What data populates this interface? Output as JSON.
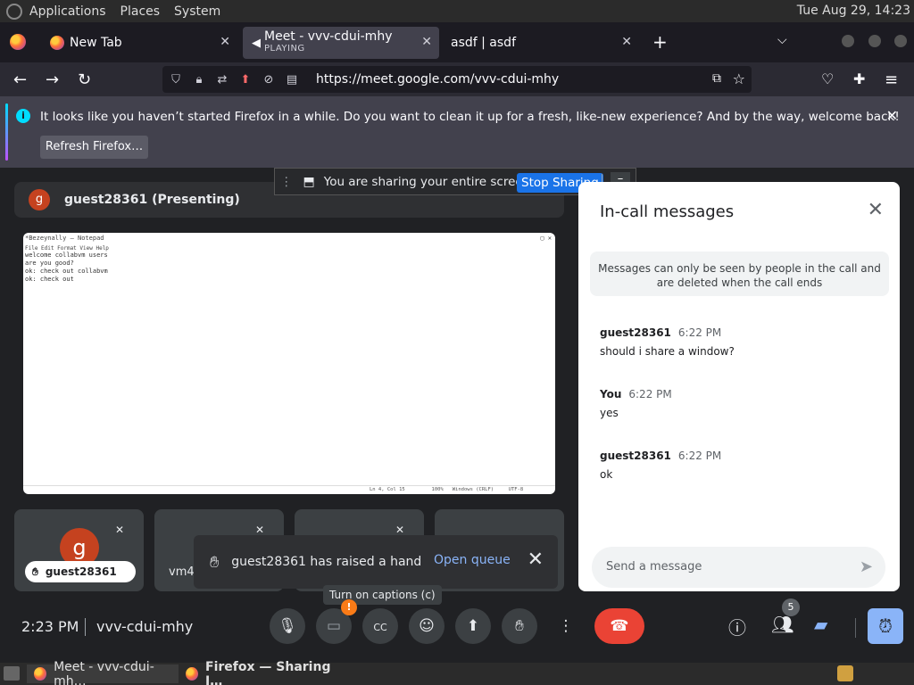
{
  "system": {
    "menus": [
      "Applications",
      "Places",
      "System"
    ],
    "clock": "Tue Aug 29, 14:23"
  },
  "tabs": [
    {
      "label": "New Tab"
    },
    {
      "label": "Meet - vvv-cdui-mhy",
      "sub": "PLAYING"
    },
    {
      "label": "asdf | asdf"
    }
  ],
  "url": "https://meet.google.com/vvv-cdui-mhy",
  "notification": {
    "message": "It looks like you haven’t started Firefox in a while. Do you want to clean it up for a fresh, like-new experience? And by the way, welcome back!",
    "button": "Refresh Firefox…"
  },
  "sharing": {
    "message": "You are sharing your entire screen.",
    "stop": "Stop Sharing",
    "minimize": "–"
  },
  "presenter": {
    "initial": "g",
    "label": "guest28361 (Presenting)"
  },
  "shared_screen": {
    "title": "*Bezeynally — Notepad",
    "menu": "File  Edit  Format  View  Help",
    "lines": [
      "welcome collabvm users",
      "are you good?",
      "ok: check out collabvm",
      "ok: check out"
    ],
    "status": "Ln 4, Col 15         100%   Windows (CRLF)     UTF-8"
  },
  "tiles": [
    {
      "initial": "g",
      "name": "guest28361"
    },
    {
      "name": "vm4"
    }
  ],
  "toast": {
    "message": "guest28361 has raised a hand",
    "action": "Open queue"
  },
  "tooltip": "Turn on captions (c)",
  "chat": {
    "title": "In-call messages",
    "notice": "Messages can only be seen by people in the call and are deleted when the call ends",
    "messages": [
      {
        "sender": "guest28361",
        "time": "6:22 PM",
        "text": "should i share a window?"
      },
      {
        "sender": "You",
        "time": "6:22 PM",
        "text": "yes"
      },
      {
        "sender": "guest28361",
        "time": "6:22 PM",
        "text": "ok"
      }
    ],
    "placeholder": "Send a message"
  },
  "controls": {
    "time": "2:23 PM",
    "meeting_code": "vvv-cdui-mhy",
    "camera_badge": "!",
    "people_count": "5"
  },
  "taskbar": [
    {
      "label": "Meet - vvv-cdui-mh…"
    },
    {
      "label": "Firefox — Sharing I…"
    }
  ]
}
